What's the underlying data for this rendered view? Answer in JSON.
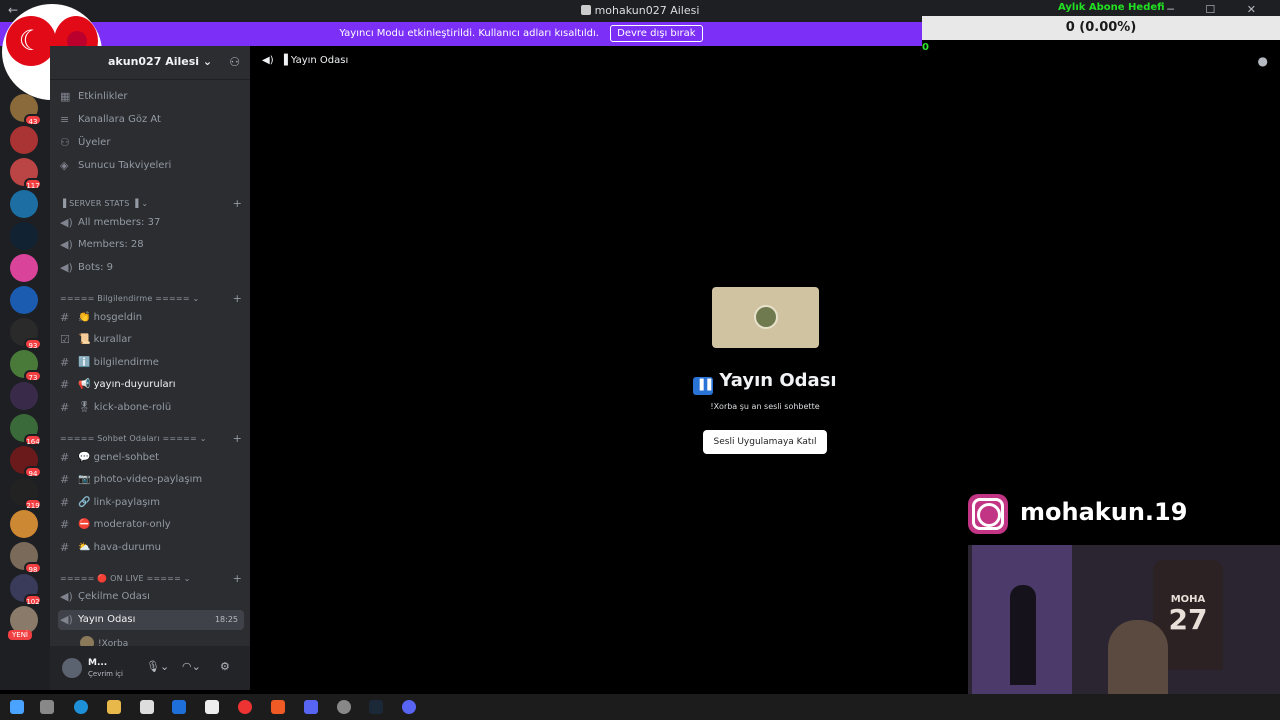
{
  "window": {
    "title": "mohakun027 Ailesi",
    "back": "←",
    "controls": "─ ☐ ✕"
  },
  "banner": {
    "text": "Yayıncı Modu etkinleştirildi. Kullanıcı adları kısaltıldı.",
    "button": "Devre dışı bırak",
    "color": "#7b2ff7"
  },
  "overlay": {
    "goal_title": "Aylık Abone Hedefi",
    "goal_value": "0 (0.00%)",
    "goal_counter": "0",
    "instagram_handle": "mohakun.19",
    "jersey_name": "MOHA",
    "jersey_number": "27"
  },
  "rail": {
    "badges": [
      "43",
      "117",
      "93",
      "73",
      "164",
      "94",
      "219",
      "98",
      "102"
    ],
    "new_label": "YENİ"
  },
  "sidebar": {
    "server_name": "akun027 Ailesi",
    "top_items": [
      "Etkinlikler",
      "Kanallara Göz At",
      "Üyeler",
      "Sunucu Takviyeleri"
    ],
    "categories": {
      "stats": "SERVER STATS",
      "info": "===== Bilgilendirme =====",
      "chat": "===== Sohbet Odaları =====",
      "live": "===== 🔴 ON LIVE ====="
    },
    "stats_items": [
      "All members: 37",
      "Members: 28",
      "Bots: 9"
    ],
    "info_items": [
      "👏 hoşgeldin",
      "📜 kurallar",
      "ℹ️ bilgilendirme",
      "📢 yayın-duyuruları",
      "🎖 kick-abone-rolü"
    ],
    "chat_items": [
      "💬 genel-sohbet",
      "📷 photo-video-paylaşım",
      "🔗 link-paylaşım",
      "⛔ moderator-only",
      "⛅ hava-durumu"
    ],
    "live_items": [
      "Çekilme Odası",
      "Yayın Odası"
    ],
    "live_time": "18:25",
    "voice_user": "!Xorba"
  },
  "user": {
    "name": "M...",
    "status": "Çevrim içi"
  },
  "channel_header": {
    "name": "Yayın Odası"
  },
  "stage": {
    "title": "Yayın Odası",
    "subtitle": "!Xorba şu an sesli sohbette",
    "join_button": "Sesli Uygulamaya Katıl"
  },
  "colors": {
    "accent": "#7b2ff7",
    "sidebar": "#2b2d31",
    "rail": "#1e1f22",
    "badge": "#f23f42"
  }
}
